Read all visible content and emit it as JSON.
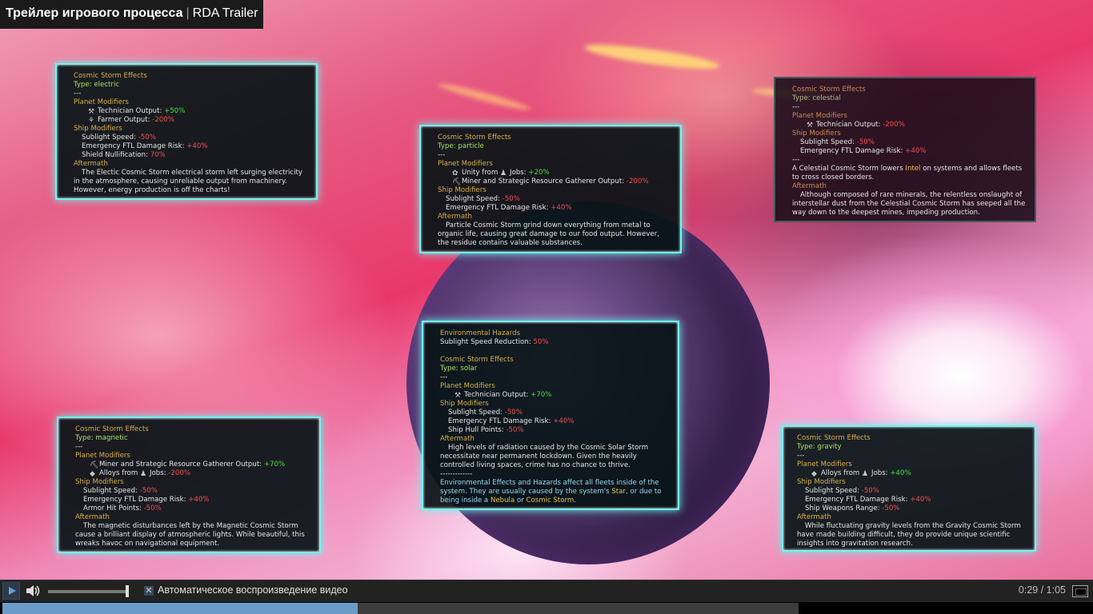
{
  "header": {
    "title_bold": "Трейлер игрового процесса",
    "separator": "|",
    "title_suffix": "RDA Trailer"
  },
  "panels": {
    "electric": {
      "heading": "Cosmic Storm Effects",
      "type": "Type: electric",
      "sep": "---",
      "planet_label": "Planet Modifiers",
      "m1_label": "Technician Output:",
      "m1_val": "+50%",
      "m2_label": "Farmer Output:",
      "m2_val": "-200%",
      "ship_label": "Ship Modifiers",
      "s1_label": "Sublight Speed:",
      "s1_val": "-50%",
      "s2_label": "Emergency FTL Damage Risk:",
      "s2_val": "+40%",
      "s3_label": "Shield Nullification:",
      "s3_val": "70%",
      "after_label": "Aftermath",
      "after_text": "The Electic Cosmic Storm electrical storm left surging electricity in the atmosphere, causing unreliable output from machinery. However, energy production is off the charts!"
    },
    "particle": {
      "heading": "Cosmic Storm Effects",
      "type": "Type: particle",
      "sep": "---",
      "planet_label": "Planet Modifiers",
      "m1_label": "Unity from",
      "m1_label2": "Jobs:",
      "m1_val": "+20%",
      "m2_label": "Miner and Strategic Resource Gatherer Output:",
      "m2_val": "-200%",
      "ship_label": "Ship Modifiers",
      "s1_label": "Sublight Speed:",
      "s1_val": "-50%",
      "s2_label": "Emergency FTL Damage Risk:",
      "s2_val": "+40%",
      "after_label": "Aftermath",
      "after_text": "Particle Cosmic Storm grind down everything from metal to organic life, causing great damage to our food output. However, the residue contains valuable substances."
    },
    "celestial": {
      "heading": "Cosmic Storm Effects",
      "type": "Type: celestial",
      "sep": "---",
      "planet_label": "Planet Modifiers",
      "m1_label": "Technician Output:",
      "m1_val": "-200%",
      "ship_label": "Ship Modifiers",
      "s1_label": "Sublight Speed:",
      "s1_val": "-50%",
      "s2_label": "Emergency FTL Damage Risk:",
      "s2_val": "+40%",
      "sep2": "---",
      "desc_a": "A Celestial Cosmic Storm lowers",
      "desc_hl": "Intel",
      "desc_b": "on systems and allows fleets to cross closed borders.",
      "after_label": "Aftermath",
      "after_text": "Although composed of rare minerals, the relentless onslaught of interstellar dust from the Celestial Cosmic Storm has seeped all the way down to the deepest mines, impeding production."
    },
    "solar": {
      "env_heading": "Environmental Hazards",
      "env_label": "Sublight Speed Reduction:",
      "env_val": "50%",
      "heading": "Cosmic Storm Effects",
      "type": "Type: solar",
      "sep": "---",
      "planet_label": "Planet Modifiers",
      "m1_label": "Technician Output:",
      "m1_val": "+70%",
      "ship_label": "Ship Modifiers",
      "s1_label": "Sublight Speed:",
      "s1_val": "-50%",
      "s2_label": "Emergency FTL Damage Risk:",
      "s2_val": "+40%",
      "s3_label": "Ship Hull Points:",
      "s3_val": "-50%",
      "after_label": "Aftermath",
      "after_text": "High levels of radiation caused by the Cosmic Solar Storm necessitate near permanent lockdown. Given the heavily controlled living spaces, crime has no chance to thrive.",
      "sep3": "-------------",
      "foot_a": "Environmental Effects and Hazards affect all fleets inside of the system. They are usually caused by the system's",
      "foot_star": "Star",
      "foot_b": ", or due to being inside a",
      "foot_nebula": "Nebula",
      "foot_or": "or",
      "foot_cosmic": "Cosmic Storm",
      "foot_end": "."
    },
    "magnetic": {
      "heading": "Cosmic Storm Effects",
      "type": "Type: magnetic",
      "sep": "---",
      "planet_label": "Planet Modifiers",
      "m1_label": "Miner and Strategic Resource Gatherer Output:",
      "m1_val": "+70%",
      "m2_label": "Alloys from",
      "m2_label2": "Jobs:",
      "m2_val": "-200%",
      "ship_label": "Ship Modifiers",
      "s1_label": "Sublight Speed:",
      "s1_val": "-50%",
      "s2_label": "Emergency FTL Damage Risk:",
      "s2_val": "+40%",
      "s3_label": "Armor Hit Points:",
      "s3_val": "-50%",
      "after_label": "Aftermath",
      "after_text": "The magnetic disturbances left by the Magnetic Cosmic Storm cause a brilliant display of atmospheric lights. While beautiful, this wreaks havoc on navigational equipment."
    },
    "gravity": {
      "heading": "Cosmic Storm Effects",
      "type": "Type: gravity",
      "sep": "---",
      "planet_label": "Planet Modifiers",
      "m1_label": "Alloys from",
      "m1_label2": "Jobs:",
      "m1_val": "+40%",
      "ship_label": "Ship Modifiers",
      "s1_label": "Sublight Speed:",
      "s1_val": "-50%",
      "s2_label": "Emergency FTL Damage Risk:",
      "s2_val": "+40%",
      "s3_label": "Ship Weapons Range:",
      "s3_val": "-50%",
      "after_label": "Aftermath",
      "after_text": "While fluctuating gravity levels from the Gravity Cosmic Storm have made building difficult, they do provide unique scientific insights into gravitation research."
    }
  },
  "controls": {
    "autoplay_label": "Автоматическое воспроизведение видео",
    "autoplay_checked": "✕",
    "time": "0:29 / 1:05",
    "progress_fraction": 0.446,
    "volume_fraction": 1.0
  },
  "icons": {
    "play": "play-icon",
    "volume": "volume-icon",
    "fullscreen": "fullscreen-icon",
    "wrench": "wrench-icon",
    "pop": "pop-icon"
  }
}
